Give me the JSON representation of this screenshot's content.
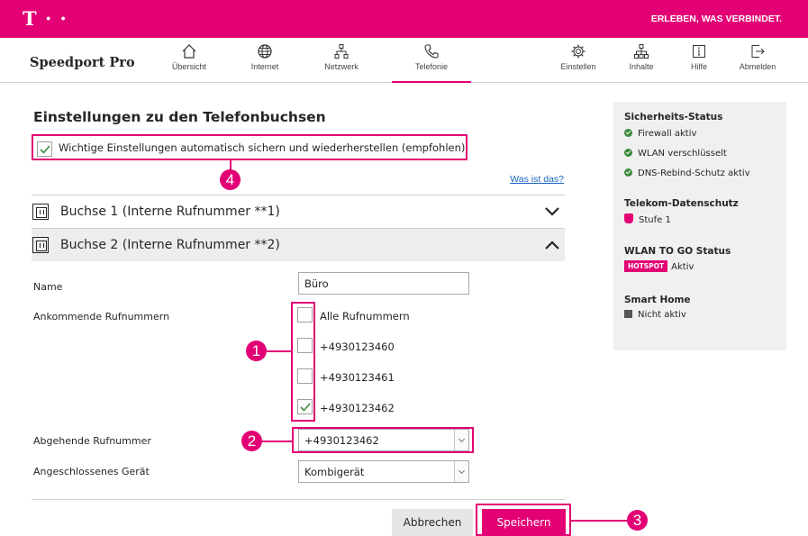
{
  "topbar": {
    "logo": "T · ·",
    "tagline": "ERLEBEN, WAS VERBINDET."
  },
  "navbar": {
    "brand": "Speedport Pro",
    "items": [
      {
        "label": "Übersicht",
        "icon": "home-icon"
      },
      {
        "label": "Internet",
        "icon": "globe-icon"
      },
      {
        "label": "Netzwerk",
        "icon": "network-icon"
      },
      {
        "label": "Telefonie",
        "icon": "phone-icon",
        "active": true
      },
      {
        "label": "Einstellen",
        "icon": "gear-icon"
      },
      {
        "label": "Inhalte",
        "icon": "content-icon"
      },
      {
        "label": "Hilfe",
        "icon": "help-icon"
      },
      {
        "label": "Abmelden",
        "icon": "logout-icon"
      }
    ]
  },
  "main": {
    "title": "Einstellungen zu den Telefonbuchsen",
    "autosave_label": "Wichtige Einstellungen automatisch sichern und wiederherstellen (empfohlen)",
    "autosave_checked": true,
    "help_link": "Was ist das?",
    "accordions": [
      {
        "label": "Buchse 1 (Interne Rufnummer **1)",
        "open": false
      },
      {
        "label": "Buchse 2 (Interne Rufnummer **2)",
        "open": true
      }
    ],
    "form": {
      "name_label": "Name",
      "name_value": "Büro",
      "incoming_label": "Ankommende Rufnummern",
      "incoming_options": [
        {
          "label": "Alle Rufnummern",
          "checked": false
        },
        {
          "label": "+4930123460",
          "checked": false
        },
        {
          "label": "+4930123461",
          "checked": false
        },
        {
          "label": "+4930123462",
          "checked": true
        }
      ],
      "outgoing_label": "Abgehende Rufnummer",
      "outgoing_value": "+4930123462",
      "device_label": "Angeschlossenes Gerät",
      "device_value": "Kombigerät"
    },
    "buttons": {
      "cancel": "Abbrechen",
      "save": "Speichern"
    },
    "callouts": [
      "1",
      "2",
      "3",
      "4"
    ]
  },
  "sidebar": {
    "security_title": "Sicherheits-Status",
    "security_items": [
      "Firewall aktiv",
      "WLAN verschlüsselt",
      "DNS-Rebind-Schutz aktiv"
    ],
    "privacy_title": "Telekom-Datenschutz",
    "privacy_value": "Stufe 1",
    "wlan_title": "WLAN TO GO Status",
    "hotspot_badge": "HOTSPOT",
    "wlan_value": "Aktiv",
    "smarthome_title": "Smart Home",
    "smarthome_value": "Nicht aktiv"
  },
  "colors": {
    "brand": "#e20074",
    "ok": "#3a8a3a",
    "link": "#1a66c2"
  }
}
